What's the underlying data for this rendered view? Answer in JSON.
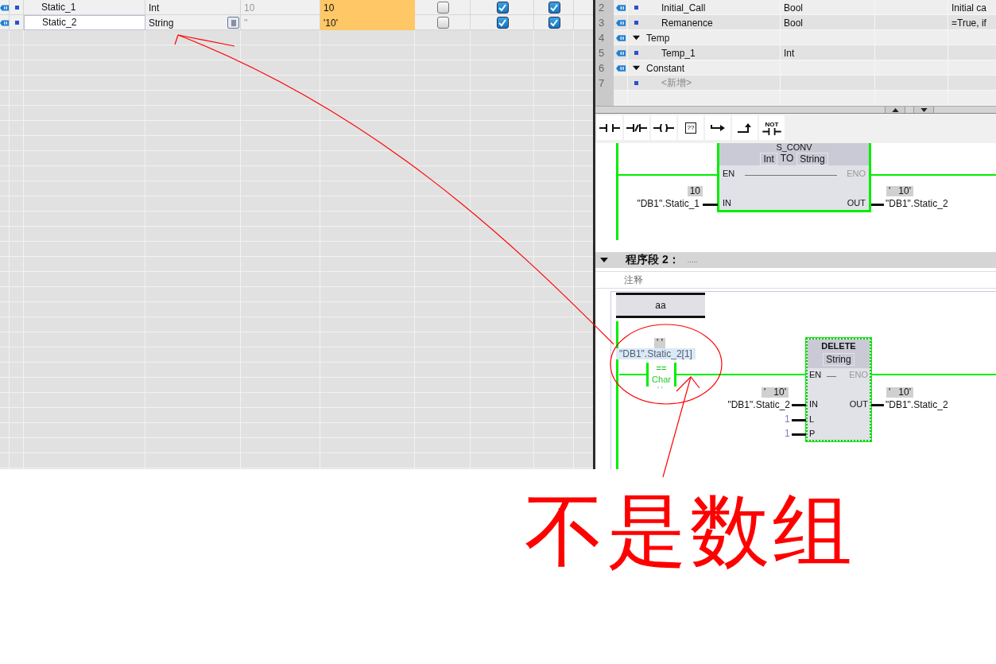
{
  "db_table": {
    "rows": [
      {
        "name": "Static_1",
        "selected": false,
        "data_type": "Int",
        "has_picker": false,
        "start_value": "10",
        "monitor_value": "10",
        "checks": [
          false,
          true,
          true
        ]
      },
      {
        "name": "Static_2",
        "selected": true,
        "data_type": "String",
        "has_picker": true,
        "start_value": "''",
        "monitor_value": "'10'",
        "checks": [
          false,
          true,
          true
        ]
      }
    ]
  },
  "interface_table": {
    "rows": [
      {
        "number": "2",
        "kind": "member",
        "name": "Initial_Call",
        "data_type": "Bool",
        "comment": "Initial ca"
      },
      {
        "number": "3",
        "kind": "member",
        "name": "Remanence",
        "data_type": "Bool",
        "comment": "=True, if"
      },
      {
        "number": "4",
        "kind": "section",
        "name": "Temp",
        "expanded": true
      },
      {
        "number": "5",
        "kind": "member",
        "name": "Temp_1",
        "data_type": "Int"
      },
      {
        "number": "6",
        "kind": "section",
        "name": "Constant",
        "expanded": true
      },
      {
        "number": "7",
        "kind": "add",
        "name": "<新增>"
      }
    ]
  },
  "toolbar": [
    {
      "kind": "open-contact"
    },
    {
      "kind": "closed-contact"
    },
    {
      "kind": "coil"
    },
    {
      "kind": "empty-box",
      "label": "??"
    },
    {
      "kind": "jump"
    },
    {
      "kind": "branch"
    },
    {
      "kind": "not",
      "label": "NOT"
    }
  ],
  "network_1": {
    "box": {
      "title": "S_CONV",
      "type_1": "Int",
      "type_to": "TO",
      "type_2": "String",
      "en": "EN",
      "eno": "ENO",
      "in": "IN",
      "out": "OUT"
    },
    "in_value": "10",
    "in_operand": "\"DB1\".Static_1",
    "out_value": "'   10'",
    "out_operand": "\"DB1\".Static_2"
  },
  "network_2": {
    "header": "程序段 2：",
    "title": ".....",
    "comment": "注释",
    "label": "aa",
    "comparator": {
      "value": "' '",
      "operand": "\"DB1\".Static_2[1]",
      "operator": "==",
      "type": "Char",
      "compare_value": "' '"
    },
    "box": {
      "title": "DELETE",
      "type": "String",
      "en": "EN",
      "eno": "ENO",
      "in": "IN",
      "out": "OUT",
      "l": "L",
      "p": "P"
    },
    "in_value": "'   10'",
    "in_operand": "\"DB1\".Static_2",
    "l_value": "1",
    "p_value": "1",
    "out_value": "'   10'",
    "out_operand": "\"DB1\".Static_2"
  },
  "annotation": {
    "note": "不是数组"
  }
}
